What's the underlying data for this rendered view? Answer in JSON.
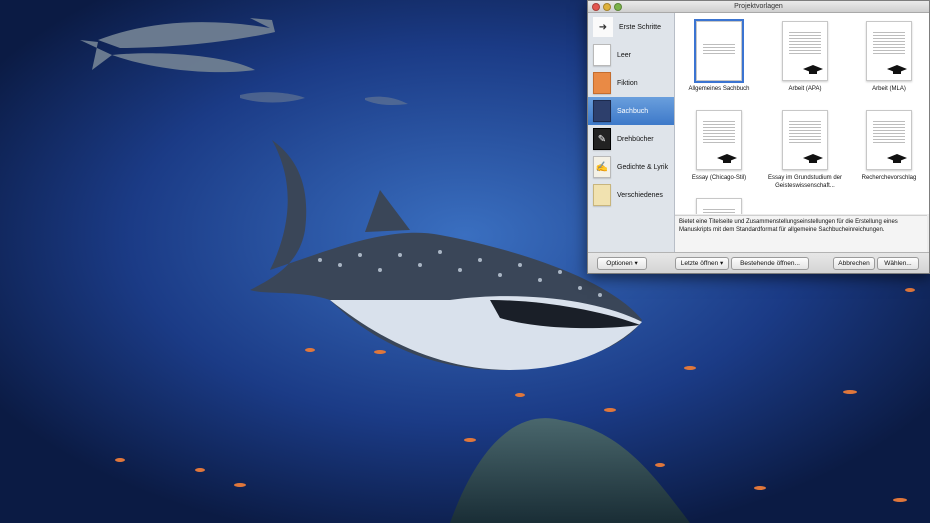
{
  "window": {
    "title": "Projektvorlagen"
  },
  "sidebar": {
    "items": [
      {
        "label": "Erste Schritte",
        "icon": "arrow-icon"
      },
      {
        "label": "Leer",
        "icon": "blank-page-icon"
      },
      {
        "label": "Fiktion",
        "icon": "fiction-icon"
      },
      {
        "label": "Sachbuch",
        "icon": "books-icon",
        "selected": true
      },
      {
        "label": "Drehbücher",
        "icon": "clapperboard-icon"
      },
      {
        "label": "Gedichte & Lyrik",
        "icon": "poem-icon"
      },
      {
        "label": "Verschiedenes",
        "icon": "misc-icon"
      }
    ]
  },
  "templates": [
    {
      "label": "Allgemeines Sachbuch",
      "selected": true
    },
    {
      "label": "Arbeit (APA)"
    },
    {
      "label": "Arbeit (MLA)"
    },
    {
      "label": "Essay (Chicago-Stil)"
    },
    {
      "label": "Essay im Grundstudium der Geisteswissenschaft..."
    },
    {
      "label": "Recherchevorschlag"
    }
  ],
  "description": "Bietet eine Titelseite und Zusammenstellungseinstellungen für die Erstellung eines Manuskripts mit dem Standardformat für allgemeine Sachbucheinreichungen.",
  "buttons": {
    "options": "Optionen",
    "recent": "Letzte öffnen",
    "existing": "Bestehende öffnen...",
    "cancel": "Abbrechen",
    "choose": "Wählen..."
  },
  "colors": {
    "accent": "#3d79c9",
    "water": "#1f3f8a"
  }
}
